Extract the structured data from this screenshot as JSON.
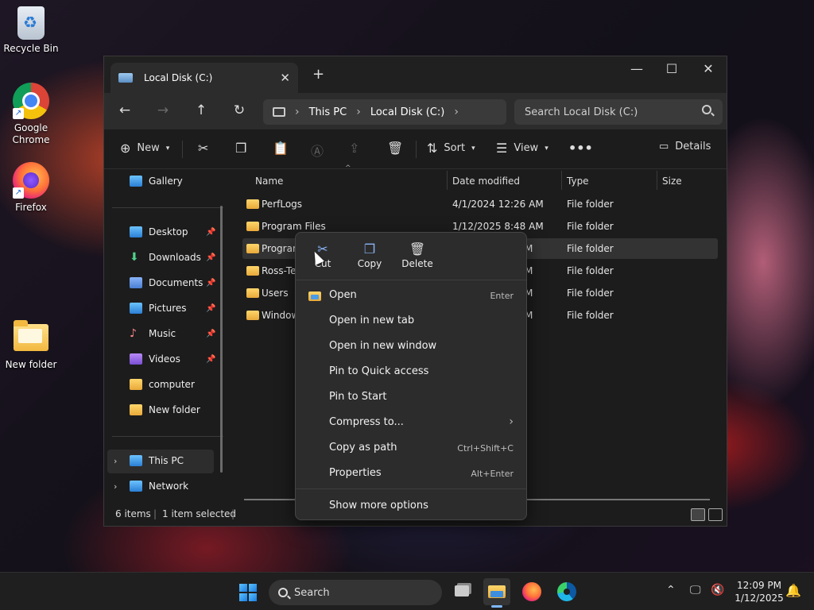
{
  "desktop": {
    "icons": [
      {
        "label": "Recycle Bin"
      },
      {
        "label": "Google\nChrome"
      },
      {
        "label": "Firefox"
      },
      {
        "label": "New folder"
      }
    ]
  },
  "window": {
    "tab_title": "Local Disk (C:)",
    "address": {
      "segments": [
        "This PC",
        "Local Disk (C:)"
      ]
    },
    "search_placeholder": "Search Local Disk (C:)",
    "toolbar": {
      "new": "New",
      "sort": "Sort",
      "view": "View",
      "details": "Details"
    },
    "nav": {
      "gallery": "Gallery",
      "quick": [
        "Desktop",
        "Downloads",
        "Documents",
        "Pictures",
        "Music",
        "Videos",
        "computer",
        "New folder"
      ],
      "this_pc": "This PC",
      "network": "Network"
    },
    "columns": {
      "name": "Name",
      "date": "Date modified",
      "type": "Type",
      "size": "Size"
    },
    "files": [
      {
        "name": "PerfLogs",
        "date": "4/1/2024 12:26 AM",
        "type": "File folder"
      },
      {
        "name": "Program Files",
        "date": "1/12/2025 8:48 AM",
        "type": "File folder"
      },
      {
        "name": "Program",
        "date": "M",
        "type": "File folder"
      },
      {
        "name": "Ross-Tec",
        "date": "M",
        "type": "File folder"
      },
      {
        "name": "Users",
        "date": "M",
        "type": "File folder"
      },
      {
        "name": "Window",
        "date": "M",
        "type": "File folder"
      }
    ],
    "status": {
      "count": "6 items",
      "selected": "1 item selected"
    }
  },
  "context_menu": {
    "quick_actions": {
      "cut": "Cut",
      "copy": "Copy",
      "delete": "Delete"
    },
    "items": [
      {
        "label": "Open",
        "shortcut": "Enter"
      },
      {
        "label": "Open in new tab",
        "shortcut": ""
      },
      {
        "label": "Open in new window",
        "shortcut": ""
      },
      {
        "label": "Pin to Quick access",
        "shortcut": ""
      },
      {
        "label": "Pin to Start",
        "shortcut": ""
      },
      {
        "label": "Compress to...",
        "shortcut": ""
      },
      {
        "label": "Copy as path",
        "shortcut": "Ctrl+Shift+C"
      },
      {
        "label": "Properties",
        "shortcut": "Alt+Enter"
      }
    ],
    "more": "Show more options"
  },
  "taskbar": {
    "search": "Search",
    "time": "12:09 PM",
    "date": "1/12/2025"
  }
}
